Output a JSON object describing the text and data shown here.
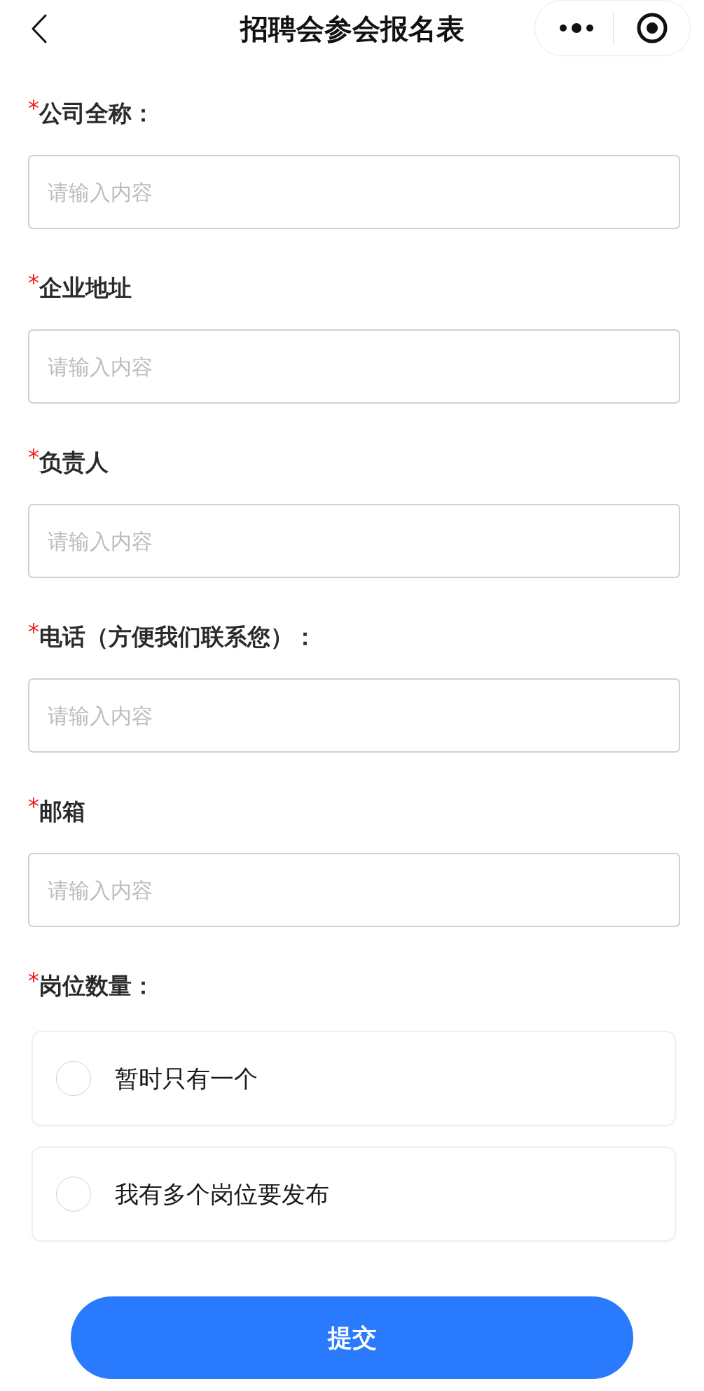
{
  "header": {
    "title": "招聘会参会报名表"
  },
  "fields": [
    {
      "required_mark": "*",
      "label": "公司全称：",
      "placeholder": "请输入内容"
    },
    {
      "required_mark": "*",
      "label": "企业地址",
      "placeholder": "请输入内容"
    },
    {
      "required_mark": "*",
      "label": "负责人",
      "placeholder": "请输入内容"
    },
    {
      "required_mark": "*",
      "label": "电话（方便我们联系您）：",
      "placeholder": "请输入内容"
    },
    {
      "required_mark": "*",
      "label": "邮箱",
      "placeholder": "请输入内容"
    }
  ],
  "radio_question": {
    "required_mark": "*",
    "label": "岗位数量：",
    "options": [
      {
        "label": "暂时只有一个",
        "selected": false
      },
      {
        "label": "我有多个岗位要发布",
        "selected": false
      }
    ]
  },
  "submit_button": {
    "label": "提交"
  }
}
